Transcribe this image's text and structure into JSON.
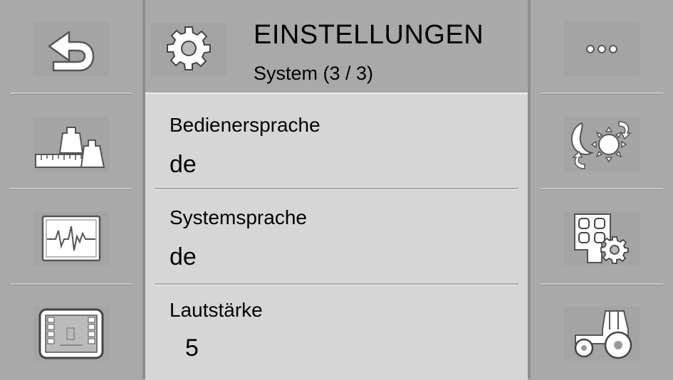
{
  "header": {
    "title": "EINSTELLUNGEN",
    "subtitle": "System (3 / 3)",
    "icon": "gear-icon"
  },
  "left_sidebar": {
    "buttons": [
      {
        "icon": "back-arrow-icon"
      },
      {
        "icon": "weights-scale-icon"
      },
      {
        "icon": "diagnostics-waveform-icon"
      },
      {
        "icon": "terminal-screen-icon"
      }
    ]
  },
  "right_sidebar": {
    "buttons": [
      {
        "icon": "more-icon",
        "label": "..."
      },
      {
        "icon": "day-night-mode-icon"
      },
      {
        "icon": "keypad-settings-icon"
      },
      {
        "icon": "tractor-icon"
      }
    ]
  },
  "settings": [
    {
      "label": "Bedienersprache",
      "value": "de"
    },
    {
      "label": "Systemsprache",
      "value": "de"
    },
    {
      "label": "Lautstärke",
      "value": "5"
    }
  ],
  "colors": {
    "panel": "#a9a9a9",
    "content": "#d6d6d6",
    "text": "#000000"
  }
}
